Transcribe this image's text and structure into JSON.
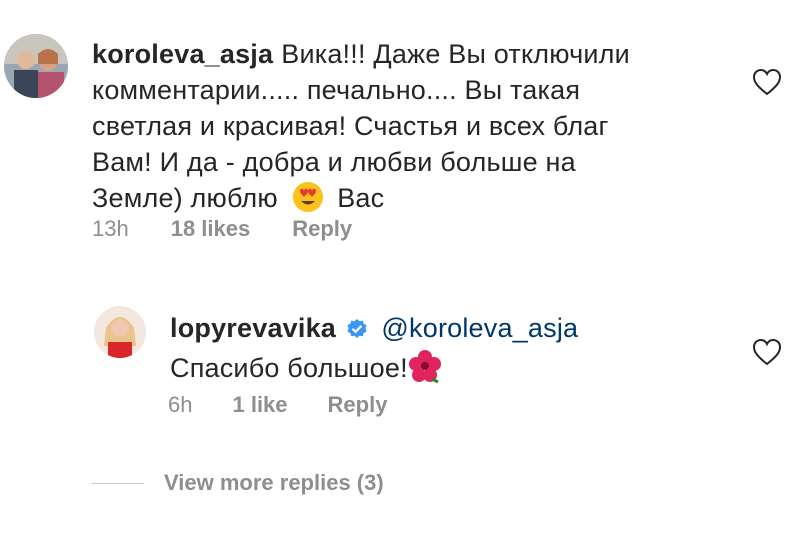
{
  "comments": [
    {
      "username": "koroleva_asja",
      "lines": [
        "Вика!!! Даже Вы отключили",
        "комментарии..... печально.... Вы такая",
        "светлая и красивая! Счастья и всех благ",
        "Вам! И да - добра и любви больше на"
      ],
      "last_line_before_emoji": "Земле) люблю",
      "last_line_after_emoji": "Вас",
      "emoji": "heart-eyes-emoji",
      "time": "13h",
      "likes": "18 likes",
      "reply_label": "Reply"
    }
  ],
  "reply": {
    "username": "lopyrevavika",
    "verified": true,
    "mention": "@koroleva_asja",
    "text": "Спасибо большое!",
    "emoji": "hibiscus-emoji",
    "time": "6h",
    "likes": "1 like",
    "reply_label": "Reply"
  },
  "view_more": "View more replies (3)",
  "colors": {
    "text": "#262626",
    "meta": "#8e8e8e",
    "mention": "#00376b",
    "verified": "#3897f0"
  }
}
